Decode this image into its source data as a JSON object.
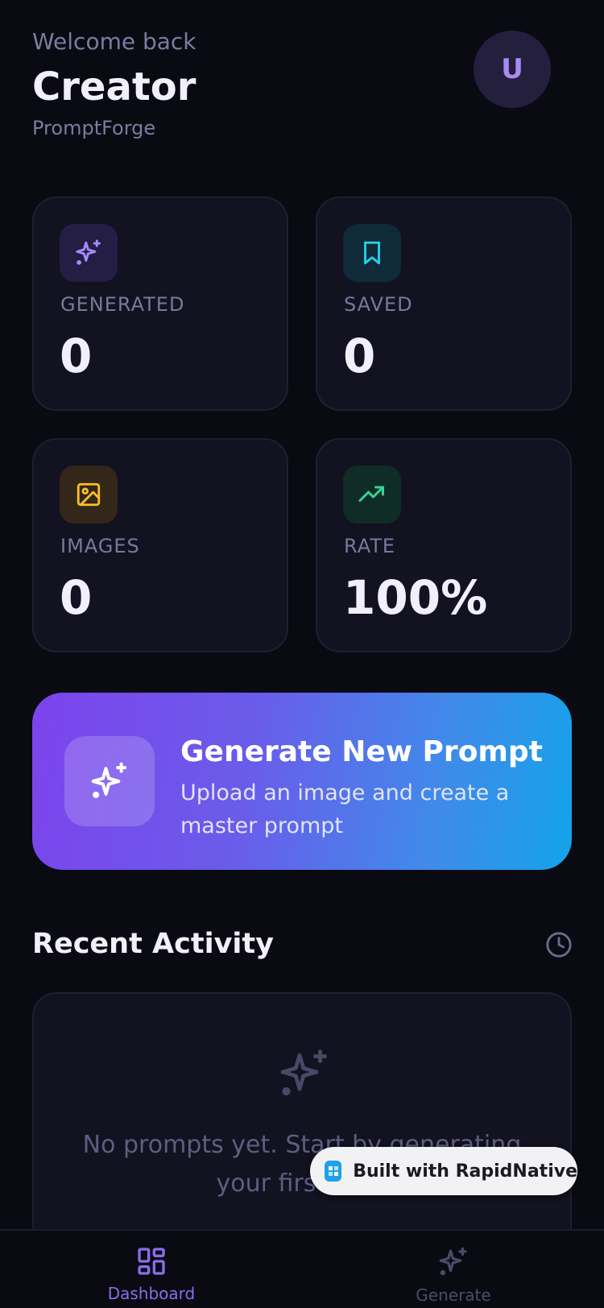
{
  "header": {
    "welcome": "Welcome back",
    "name": "Creator",
    "brand": "PromptForge",
    "avatar_initial": "U"
  },
  "stats": [
    {
      "label": "GENERATED",
      "value": "0",
      "icon": "sparkles-icon",
      "color": "#a78bfa"
    },
    {
      "label": "SAVED",
      "value": "0",
      "icon": "bookmark-icon",
      "color": "#22d3ee"
    },
    {
      "label": "IMAGES",
      "value": "0",
      "icon": "image-icon",
      "color": "#fbbf24"
    },
    {
      "label": "RATE",
      "value": "100%",
      "icon": "trending-up-icon",
      "color": "#34d399"
    }
  ],
  "cta": {
    "title": "Generate New Prompt",
    "subtitle": "Upload an image and create a master prompt",
    "icon": "sparkles-icon"
  },
  "recent": {
    "title": "Recent Activity",
    "icon": "clock-icon",
    "empty_text": "No prompts yet. Start by generating your first one!"
  },
  "badge": {
    "text": "Built with RapidNative"
  },
  "nav": [
    {
      "label": "Dashboard",
      "icon": "dashboard-grid-icon",
      "active": true
    },
    {
      "label": "Generate",
      "icon": "sparkles-icon",
      "active": false
    }
  ],
  "colors": {
    "background": "#0a0a13",
    "card": "#121220",
    "accent": "#8b5cf6",
    "cta_gradient_start": "#7d43ec",
    "cta_gradient_end": "#13a3ea"
  }
}
